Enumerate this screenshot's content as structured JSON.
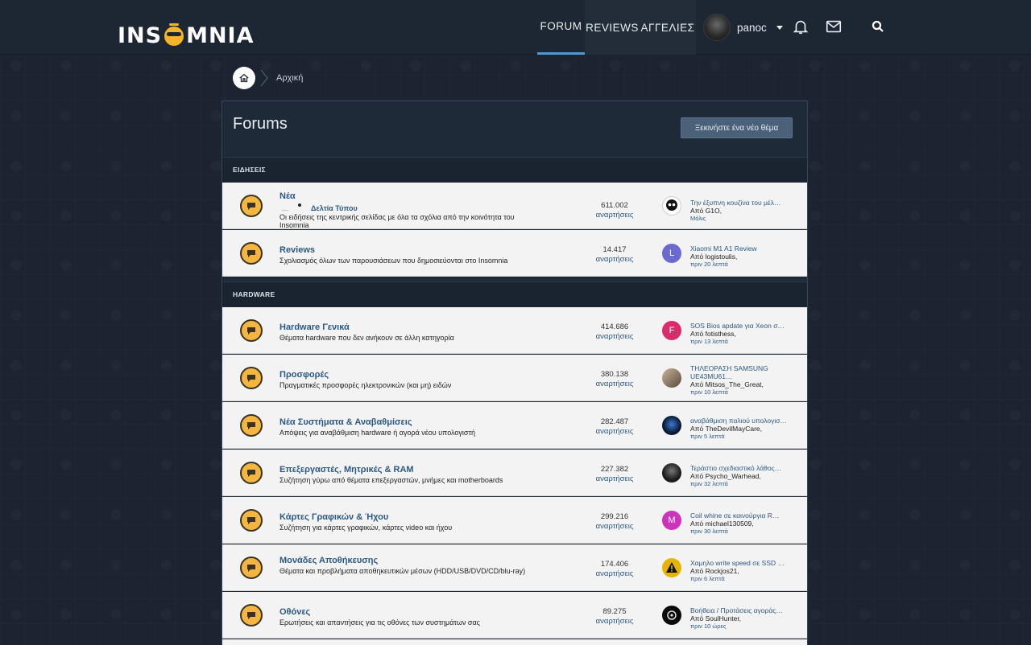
{
  "header": {
    "logo_text_left": "INS",
    "logo_text_right": "MNIA",
    "nav": [
      {
        "label": "FORUM"
      },
      {
        "label": "REVIEWS"
      },
      {
        "label": "ΑΓΓΕΛΙΕΣ"
      }
    ],
    "username": "panoc",
    "icons": [
      "bell-icon",
      "mail-icon",
      "search-icon"
    ]
  },
  "breadcrumb": {
    "home_icon": "home-icon",
    "current": "Αρχική"
  },
  "page": {
    "title": "Forums",
    "new_thread_label": "Ξεκινήστε ένα νέο θέμα"
  },
  "categories": [
    {
      "label": "ΕΙΔΗΣΕΙΣ"
    },
    {
      "label": "HARDWARE"
    }
  ],
  "forums": [
    {
      "name": "Νέα",
      "desc": "Οι ειδήσεις της κεντρικής σελίδας με όλα τα σχόλια από την κοινότητα του Insomnia",
      "sub": "Δελτία Τύπου",
      "posts": "611.002",
      "posts_label": "αναρτήσεις",
      "last_title": "Την έξυπνη κουζίνα του μέλ…",
      "last_by": "Από G1O,",
      "last_time": "Μόλις",
      "avatar_color": "#ffffff",
      "avatar_letter": ""
    },
    {
      "name": "Reviews",
      "desc": "Σχολιασμός όλων των παρουσιάσεων που δημοσιεύονται στο Insomnia",
      "posts": "14.417",
      "posts_label": "αναρτήσεις",
      "last_title": "Xiaomi M1 A1 Review",
      "last_by": "Από logistoulis,",
      "last_time": "πριν 20 λεπτά",
      "avatar_color": "#6a6ad0",
      "avatar_letter": "L"
    },
    {
      "name": "Hardware Γενικά",
      "desc": "Θέματα hardware που δεν ανήκουν σε άλλη κατηγορία",
      "posts": "414.686",
      "posts_label": "αναρτήσεις",
      "last_title": "SOS Bios apdate για Xeon σ…",
      "last_by": "Από fotisthess,",
      "last_time": "πριν 13 λεπτά",
      "avatar_color": "#d92c6c",
      "avatar_letter": "F"
    },
    {
      "name": "Προσφορές",
      "desc": "Πραγματικές προσφορές ηλεκτρονικών (και μη) ειδών",
      "posts": "380.138",
      "posts_label": "αναρτήσεις",
      "last_title": "ΤΗΛΕΟΡΑΣΗ SAMSUNG UE43MU61…",
      "last_by": "Από Mitsos_The_Great,",
      "last_time": "πριν 10 λεπτά",
      "avatar_color": "#8a7a6a",
      "avatar_letter": ""
    },
    {
      "name": "Νέα Συστήματα & Αναβαθμίσεις",
      "desc": "Απόψεις για αναβάθμιση hardware ή αγορά νέου υπολογιστή",
      "posts": "282.487",
      "posts_label": "αναρτήσεις",
      "last_title": "αναβάθμιση παλιού υπολογισ…",
      "last_by": "Από TheDevilMayCare,",
      "last_time": "πριν 5 λεπτά",
      "avatar_color": "#0c1830",
      "avatar_letter": ""
    },
    {
      "name": "Επεξεργαστές, Μητρικές & RAM",
      "desc": "Συζήτηση γύρω από θέματα επεξεργαστών, μνήμες και motherboards",
      "posts": "227.382",
      "posts_label": "αναρτήσεις",
      "last_title": "Τεράστιο σχεδιαστικό λάθος…",
      "last_by": "Από Psycho_Warhead,",
      "last_time": "πριν 32 λεπτά",
      "avatar_color": "#1b1b1b",
      "avatar_letter": ""
    },
    {
      "name": "Κάρτες Γραφικών & Ήχου",
      "desc": "Συζήτηση για κάρτες γραφικών, κάρτες video και ήχου",
      "posts": "299.216",
      "posts_label": "αναρτήσεις",
      "last_title": "Coil whine σε καινούργια R…",
      "last_by": "Από michael130509,",
      "last_time": "πριν 30 λεπτά",
      "avatar_color": "#cc33bb",
      "avatar_letter": "M"
    },
    {
      "name": "Μονάδες Αποθήκευσης",
      "desc": "Θέματα και προβλήματα αποθηκευτικών μέσων (HDD/USB/DVD/CD/blu-ray)",
      "posts": "174.406",
      "posts_label": "αναρτήσεις",
      "last_title": "Χαμηλο write speed σε SSD …",
      "last_by": "Από Rockjos21,",
      "last_time": "πριν 6 λεπτά",
      "avatar_color": "#e6b400",
      "avatar_letter": ""
    },
    {
      "name": "Οθόνες",
      "desc": "Ερωτήσεις και απαντήσεις για τις οθόνες των συστημάτων σας",
      "posts": "89.275",
      "posts_label": "αναρτήσεις",
      "last_title": "Βοήθεια / Προτάσεις αγοράς…",
      "last_by": "Από SoulHunter,",
      "last_time": "πριν 10 ώρες",
      "avatar_color": "#0a0a0a",
      "avatar_letter": ""
    }
  ]
}
